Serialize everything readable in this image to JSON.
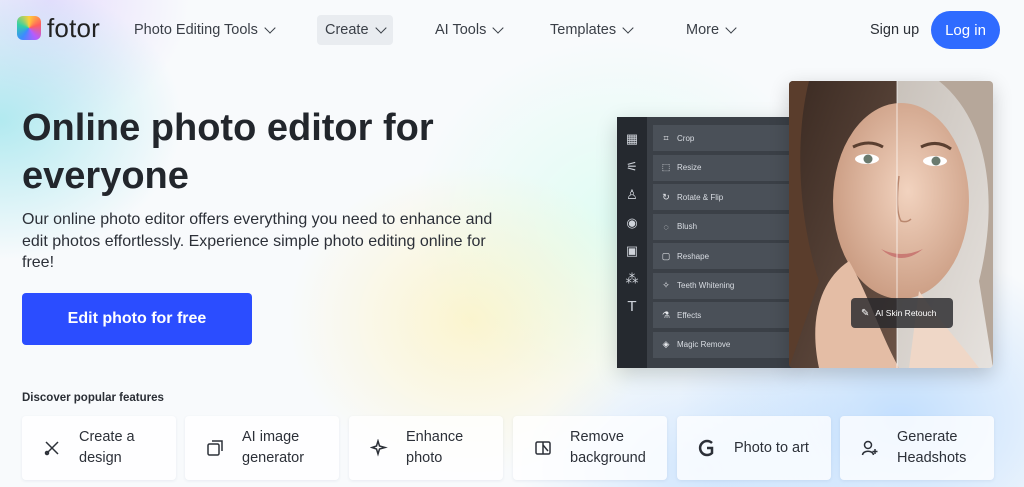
{
  "brand": {
    "name": "fotor"
  },
  "nav": {
    "items": [
      {
        "label": "Photo Editing Tools"
      },
      {
        "label": "Create"
      },
      {
        "label": "AI Tools"
      },
      {
        "label": "Templates"
      },
      {
        "label": "More"
      }
    ],
    "active_index": 1,
    "signup_label": "Sign up",
    "login_label": "Log in"
  },
  "hero": {
    "title_line1": "Online photo editor for",
    "title_line2": "everyone",
    "subtitle": "Our online photo editor offers everything you need to enhance and edit photos effortlessly. Experience simple photo editing online for free!",
    "cta_label": "Edit photo for free"
  },
  "editor_mock": {
    "tools": [
      {
        "label": "Crop",
        "icon": "crop-icon"
      },
      {
        "label": "Resize",
        "icon": "resize-icon"
      },
      {
        "label": "Rotate & Flip",
        "icon": "rotate-icon"
      },
      {
        "label": "Blush",
        "icon": "blush-icon"
      },
      {
        "label": "Reshape",
        "icon": "reshape-icon"
      },
      {
        "label": "Teeth Whitening",
        "icon": "teeth-icon"
      },
      {
        "label": "Effects",
        "icon": "effects-icon"
      },
      {
        "label": "Magic Remove",
        "icon": "eraser-icon"
      }
    ],
    "badge_label": "AI Skin Retouch"
  },
  "features": {
    "heading": "Discover popular features",
    "items": [
      {
        "line1": "Create a",
        "line2": "design",
        "icon": "design-tools-icon"
      },
      {
        "line1": "AI image",
        "line2": "generator",
        "icon": "ai-image-icon"
      },
      {
        "line1": "Enhance",
        "line2": "photo",
        "icon": "sparkle-icon"
      },
      {
        "line1": "Remove",
        "line2": "background",
        "icon": "remove-bg-icon"
      },
      {
        "line1": "Photo to art",
        "line2": "",
        "icon": "art-logo-icon"
      },
      {
        "line1": "Generate",
        "line2": "Headshots",
        "icon": "add-user-icon"
      }
    ]
  },
  "colors": {
    "primary": "#2b4dff",
    "login": "#2f6bff",
    "text": "#22262c",
    "editor_bg": "#3b4047"
  }
}
